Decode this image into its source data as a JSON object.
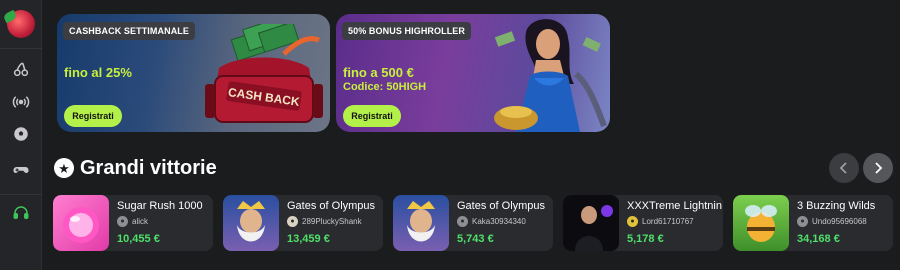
{
  "sidebar": {
    "icons": [
      "logo",
      "cherries-icon",
      "live-signal-icon",
      "soccer-ball-icon",
      "gamepad-icon",
      "headset-icon"
    ]
  },
  "banners": [
    {
      "tag": "CASHBACK SETTIMANALE",
      "headline": "fino al 25%",
      "subline": "",
      "button": "Registrati",
      "art_text": "CASH BACK"
    },
    {
      "tag": "50% BONUS HIGHROLLER",
      "headline": "fino a 500 €",
      "subline": "Codice: 50HIGH",
      "button": "Registrati"
    }
  ],
  "section": {
    "title": "Grandi vittorie"
  },
  "wins": [
    {
      "game": "Sugar Rush 1000",
      "user": "alick",
      "amount": "10,455 €"
    },
    {
      "game": "Gates of Olympus",
      "user": "289PluckyShank",
      "amount": "13,459 €"
    },
    {
      "game": "Gates of Olympus",
      "user": "Kaka30934340",
      "amount": "5,743 €"
    },
    {
      "game": "XXXTreme Lightnin",
      "user": "Lord61710767",
      "amount": "5,178 €"
    },
    {
      "game": "3 Buzzing Wilds",
      "user": "Undo95696068",
      "amount": "34,168 €"
    }
  ],
  "colors": {
    "accent_green": "#b4f04a",
    "amount_green": "#4ee06a",
    "background": "#1b1c1e"
  }
}
